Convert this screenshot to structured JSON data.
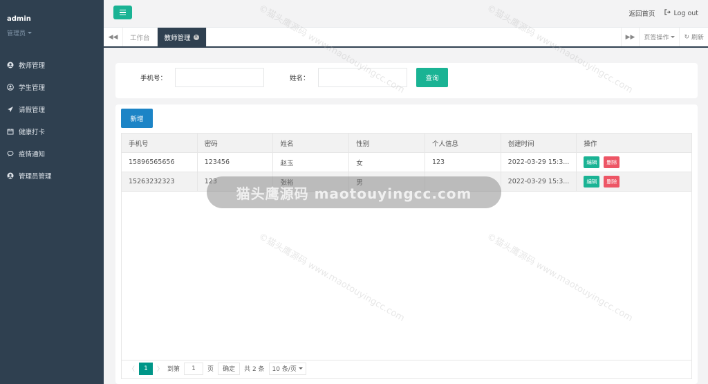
{
  "sidebar": {
    "user": "admin",
    "role": "管理员",
    "items": [
      {
        "label": "教师管理",
        "icon": "user-circle-icon"
      },
      {
        "label": "学生管理",
        "icon": "user-icon"
      },
      {
        "label": "请假管理",
        "icon": "send-icon"
      },
      {
        "label": "健康打卡",
        "icon": "calendar-icon"
      },
      {
        "label": "疫情通知",
        "icon": "comment-icon"
      },
      {
        "label": "管理员管理",
        "icon": "user-circle-icon"
      }
    ]
  },
  "topbar": {
    "home_link": "返回首页",
    "logout": "Log out"
  },
  "tabbar": {
    "tabs": [
      {
        "label": "工作台",
        "active": false
      },
      {
        "label": "教师管理",
        "active": true
      }
    ],
    "page_ops": "页签操作",
    "refresh": "刷新"
  },
  "search": {
    "phone_label": "手机号：",
    "name_label": "姓名：",
    "query_button": "查询"
  },
  "toolbar": {
    "add_button": "新增"
  },
  "table": {
    "columns": [
      "手机号",
      "密码",
      "姓名",
      "性别",
      "个人信息",
      "创建时间",
      "操作"
    ],
    "rows": [
      {
        "phone": "15896565656",
        "password": "123456",
        "name": "赵玉",
        "gender": "女",
        "info": "123",
        "created": "2022-03-29 15:3...",
        "edit": "编辑",
        "delete": "删除"
      },
      {
        "phone": "15263232323",
        "password": "123",
        "name": "张裕",
        "gender": "男",
        "info": "",
        "created": "2022-03-29 15:3...",
        "edit": "编辑",
        "delete": "删除"
      }
    ]
  },
  "pager": {
    "current": "1",
    "goto_label": "到第",
    "goto_value": "1",
    "page_unit": "页",
    "confirm": "确定",
    "total": "共 2 条",
    "page_size": "10 条/页"
  },
  "watermark": {
    "banner": "猫头鹰源码 maotouyingcc.com",
    "tile": "©猫头鹰源码 www.maotouyingcc.com"
  },
  "colors": {
    "sidebar_bg": "#2f4050",
    "primary_green": "#1ab394",
    "add_blue": "#1c84c6",
    "delete_red": "#ed5565"
  }
}
